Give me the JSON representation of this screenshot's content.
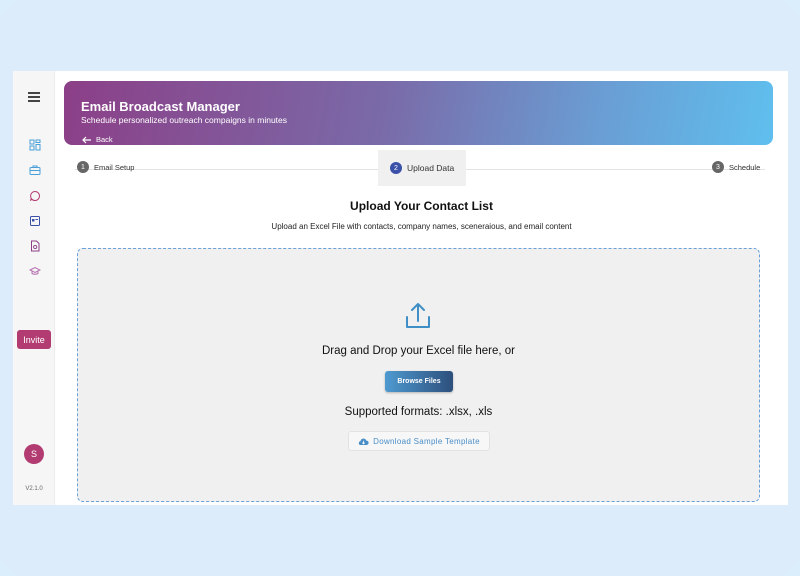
{
  "app": {
    "title": "Email Broadcast Manager",
    "subtitle": "Schedule personalized outreach compaigns in minutes",
    "back_label": "Back"
  },
  "sidebar": {
    "icons": [
      "dashboard-icon",
      "briefcase-icon",
      "chat-icon",
      "calendar-icon",
      "document-icon",
      "graduation-cap-icon"
    ],
    "invite_label": "Invite",
    "avatar_initial": "S",
    "version": "V2.1.0"
  },
  "stepper": {
    "steps": [
      {
        "num": "1",
        "label": "Email Setup",
        "active": false
      },
      {
        "num": "2",
        "label": "Upload Data",
        "active": true
      },
      {
        "num": "3",
        "label": "Schedule",
        "active": false
      }
    ]
  },
  "main": {
    "title": "Upload Your Contact List",
    "subtitle": "Upload an Excel File with contacts, company names, sceneraious, and email content",
    "drop_text": "Drag and Drop your Excel file here, or",
    "browse_label": "Browse Files",
    "formats_text": "Supported formats: .xlsx, .xls",
    "sample_label": "Download Sample Template"
  },
  "colors": {
    "accent": "#b23b72",
    "primary": "#3b50a8",
    "link": "#4a8ec8",
    "header_gradient_start": "#8c3f87",
    "header_gradient_end": "#5fbfee"
  }
}
